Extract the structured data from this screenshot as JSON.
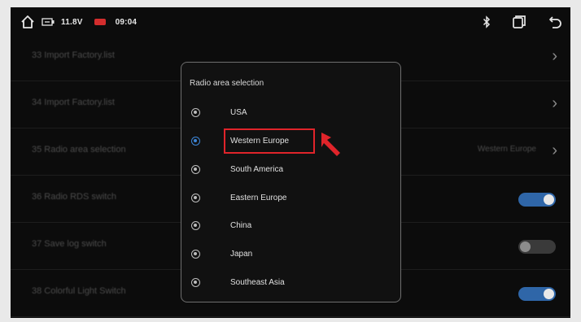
{
  "status": {
    "voltage": "11.8V",
    "time": "09:04"
  },
  "settings": [
    {
      "label": "33  Import Factory.list",
      "control": "chevron",
      "value": ""
    },
    {
      "label": "34  Import Factory.list",
      "control": "chevron",
      "value": ""
    },
    {
      "label": "35  Radio area selection",
      "control": "chevron",
      "value": "Western Europe"
    },
    {
      "label": "36  Radio RDS switch",
      "control": "toggle",
      "on": true
    },
    {
      "label": "37  Save log switch",
      "control": "toggle",
      "on": false
    },
    {
      "label": "38  Colorful Light Switch",
      "control": "toggle",
      "on": true
    }
  ],
  "dialog": {
    "title": "Radio area selection",
    "options": [
      "USA",
      "Western Europe",
      "South America",
      "Eastern Europe",
      "China",
      "Japan",
      "Southeast Asia"
    ],
    "selected": "Western Europe",
    "highlighted": "Western Europe"
  },
  "colors": {
    "accent": "#3d86d8",
    "toggle_on": "#2f66a8",
    "highlight": "#e0242a"
  },
  "icons": [
    "home-icon",
    "battery-icon",
    "bluetooth-icon",
    "window-icon",
    "back-icon",
    "arrow-pointer-icon"
  ]
}
